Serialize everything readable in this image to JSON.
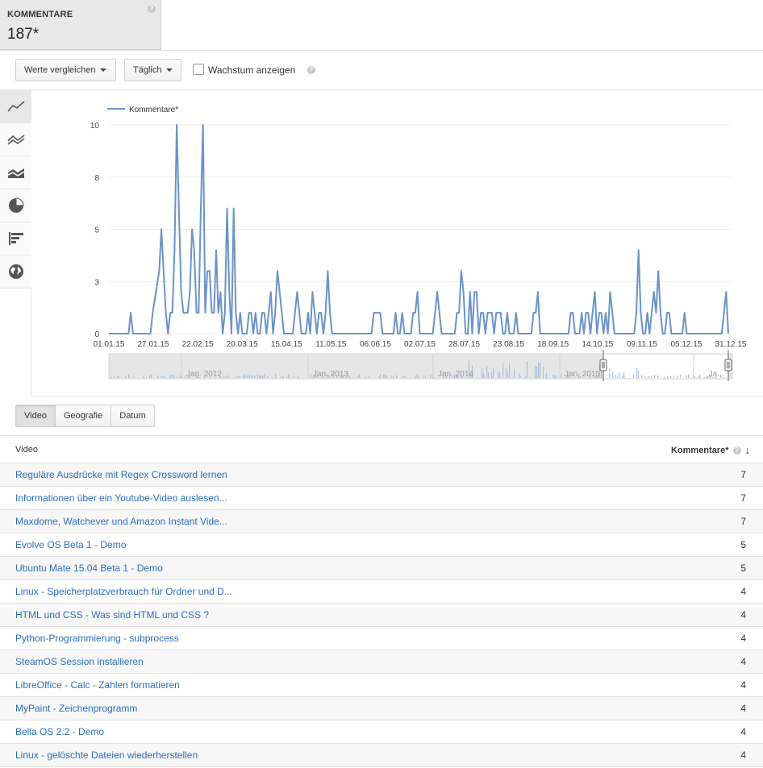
{
  "metric": {
    "label": "KOMMENTARE",
    "value": "187*",
    "help": "?"
  },
  "toolbar": {
    "compare_label": "Werte vergleichen",
    "interval_label": "Täglich",
    "growth_label": "Wachstum anzeigen",
    "growth_checked": false,
    "help": "?"
  },
  "chart_tools": [
    "line-chart-icon",
    "multi-line-icon",
    "stacked-area-icon",
    "pie-chart-icon",
    "bar-chart-icon",
    "globe-icon"
  ],
  "chart_data": {
    "type": "line",
    "legend": "Kommentare*",
    "legend_placement": "top-left",
    "color": "#6a93c7",
    "grid": true,
    "yticks": [
      "0",
      "3",
      "5",
      "8",
      "10"
    ],
    "ylim": [
      0,
      10
    ],
    "xticks": [
      "01.01.15",
      "27.01.15",
      "22.02.15",
      "20.03.15",
      "15.04.15",
      "11.05.15",
      "06.06.15",
      "02.07.15",
      "28.07.15",
      "23.08.15",
      "18.09.15",
      "14.10.15",
      "09.11.15",
      "05.12.15",
      "31.12.15"
    ],
    "series": [
      {
        "name": "Kommentare*",
        "points": [
          [
            0,
            0
          ],
          [
            9,
            0
          ],
          [
            10,
            1
          ],
          [
            11,
            0
          ],
          [
            19,
            0
          ],
          [
            20,
            1
          ],
          [
            23,
            3
          ],
          [
            24,
            5
          ],
          [
            25,
            3
          ],
          [
            26,
            1
          ],
          [
            27,
            0
          ],
          [
            28,
            1
          ],
          [
            29,
            1
          ],
          [
            30,
            4
          ],
          [
            31,
            10
          ],
          [
            32,
            6
          ],
          [
            33,
            2
          ],
          [
            34,
            1
          ],
          [
            35,
            1
          ],
          [
            36,
            1
          ],
          [
            37,
            2
          ],
          [
            38,
            5
          ],
          [
            39,
            4
          ],
          [
            40,
            1
          ],
          [
            41,
            1
          ],
          [
            42,
            6
          ],
          [
            43,
            10
          ],
          [
            44,
            1
          ],
          [
            45,
            3
          ],
          [
            46,
            3
          ],
          [
            47,
            1
          ],
          [
            48,
            1
          ],
          [
            49,
            4
          ],
          [
            50,
            1
          ],
          [
            51,
            2
          ],
          [
            52,
            0
          ],
          [
            53,
            1
          ],
          [
            54,
            6
          ],
          [
            55,
            2
          ],
          [
            56,
            0
          ],
          [
            57,
            6
          ],
          [
            58,
            1
          ],
          [
            59,
            0
          ],
          [
            60,
            1
          ],
          [
            61,
            0
          ],
          [
            63,
            0
          ],
          [
            64,
            1
          ],
          [
            65,
            1
          ],
          [
            66,
            0
          ],
          [
            67,
            1
          ],
          [
            68,
            0
          ],
          [
            69,
            0
          ],
          [
            70,
            1
          ],
          [
            71,
            1
          ],
          [
            72,
            0
          ],
          [
            73,
            1
          ],
          [
            74,
            2
          ],
          [
            75,
            0
          ],
          [
            76,
            1
          ],
          [
            77,
            3
          ],
          [
            78,
            2
          ],
          [
            79,
            1
          ],
          [
            80,
            0
          ],
          [
            84,
            0
          ],
          [
            85,
            1
          ],
          [
            86,
            2
          ],
          [
            87,
            1
          ],
          [
            88,
            0
          ],
          [
            90,
            0
          ],
          [
            91,
            1
          ],
          [
            92,
            0
          ],
          [
            93,
            2
          ],
          [
            94,
            1
          ],
          [
            95,
            0
          ],
          [
            96,
            1
          ],
          [
            97,
            1
          ],
          [
            98,
            0
          ],
          [
            99,
            1
          ],
          [
            100,
            3
          ],
          [
            101,
            1
          ],
          [
            102,
            0
          ],
          [
            120,
            0
          ],
          [
            121,
            1
          ],
          [
            124,
            1
          ],
          [
            125,
            0
          ],
          [
            130,
            0
          ],
          [
            131,
            1
          ],
          [
            132,
            0
          ],
          [
            133,
            0
          ],
          [
            134,
            1
          ],
          [
            135,
            0
          ],
          [
            138,
            0
          ],
          [
            139,
            1
          ],
          [
            140,
            1
          ],
          [
            141,
            2
          ],
          [
            142,
            0
          ],
          [
            148,
            0
          ],
          [
            149,
            1
          ],
          [
            150,
            2
          ],
          [
            151,
            1
          ],
          [
            152,
            0
          ],
          [
            158,
            0
          ],
          [
            159,
            1
          ],
          [
            160,
            1
          ],
          [
            161,
            3
          ],
          [
            162,
            2
          ],
          [
            163,
            0
          ],
          [
            164,
            0
          ],
          [
            165,
            2
          ],
          [
            166,
            0
          ],
          [
            167,
            2
          ],
          [
            168,
            2
          ],
          [
            169,
            0
          ],
          [
            170,
            1
          ],
          [
            171,
            1
          ],
          [
            172,
            0
          ],
          [
            173,
            1
          ],
          [
            174,
            1
          ],
          [
            175,
            1
          ],
          [
            176,
            0
          ],
          [
            177,
            1
          ],
          [
            178,
            1
          ],
          [
            179,
            1
          ],
          [
            180,
            0
          ],
          [
            181,
            0
          ],
          [
            182,
            1
          ],
          [
            183,
            0
          ],
          [
            185,
            0
          ],
          [
            186,
            1
          ],
          [
            187,
            0
          ],
          [
            193,
            0
          ],
          [
            194,
            1
          ],
          [
            195,
            1
          ],
          [
            196,
            2
          ],
          [
            197,
            0
          ],
          [
            210,
            0
          ],
          [
            211,
            1
          ],
          [
            212,
            1
          ],
          [
            213,
            0
          ],
          [
            215,
            0
          ],
          [
            216,
            1
          ],
          [
            217,
            0
          ],
          [
            218,
            1
          ],
          [
            219,
            1
          ],
          [
            220,
            0
          ],
          [
            221,
            1
          ],
          [
            222,
            2
          ],
          [
            223,
            0
          ],
          [
            224,
            1
          ],
          [
            225,
            1
          ],
          [
            226,
            0
          ],
          [
            227,
            1
          ],
          [
            228,
            0
          ],
          [
            229,
            2
          ],
          [
            230,
            1
          ],
          [
            231,
            0
          ],
          [
            240,
            0
          ],
          [
            241,
            1
          ],
          [
            242,
            4
          ],
          [
            243,
            1
          ],
          [
            244,
            0
          ],
          [
            245,
            0
          ],
          [
            246,
            1
          ],
          [
            247,
            0
          ],
          [
            248,
            1
          ],
          [
            249,
            2
          ],
          [
            250,
            1
          ],
          [
            251,
            3
          ],
          [
            252,
            1
          ],
          [
            253,
            0
          ],
          [
            254,
            0
          ],
          [
            255,
            1
          ],
          [
            256,
            1
          ],
          [
            257,
            0
          ],
          [
            262,
            0
          ],
          [
            263,
            1
          ],
          [
            264,
            0
          ],
          [
            280,
            0
          ],
          [
            281,
            1
          ],
          [
            282,
            2
          ],
          [
            283,
            0
          ]
        ]
      }
    ],
    "navigator": {
      "labels": [
        "Jan. 2012",
        "Jan. 2013",
        "Jan. 2014",
        "Jan. 2015",
        "Ja..."
      ]
    }
  },
  "tabs": [
    {
      "label": "Video",
      "active": true
    },
    {
      "label": "Geografie",
      "active": false
    },
    {
      "label": "Datum",
      "active": false
    }
  ],
  "table": {
    "col_title": "Video",
    "col_value": "Kommentare*",
    "help": "?",
    "sort_indicator": "↓",
    "rows": [
      {
        "title": "Reguläre Ausdrücke mit Regex Crossword lernen",
        "value": "7"
      },
      {
        "title": "Informationen über ein Youtube-Video auslesen...",
        "value": "7"
      },
      {
        "title": "Maxdome, Watchever und Amazon Instant Vide...",
        "value": "7"
      },
      {
        "title": "Evolve OS Beta 1 - Demo",
        "value": "5"
      },
      {
        "title": "Ubuntu Mate 15.04 Beta 1 - Demo",
        "value": "5"
      },
      {
        "title": "Linux - Speicherplatzverbrauch für Ordner und D...",
        "value": "4"
      },
      {
        "title": "HTML und CSS - Was sind HTML und CSS ?",
        "value": "4"
      },
      {
        "title": "Python-Programmierung - subprocess",
        "value": "4"
      },
      {
        "title": "SteamOS Session installieren",
        "value": "4"
      },
      {
        "title": "LibreOffice - Calc - Zahlen formatieren",
        "value": "4"
      },
      {
        "title": "MyPaint - Zeichenprogramm",
        "value": "4"
      },
      {
        "title": "Bella OS 2.2 - Demo",
        "value": "4"
      },
      {
        "title": "Linux - gelöschte Dateien wiederherstellen",
        "value": "4"
      }
    ]
  }
}
